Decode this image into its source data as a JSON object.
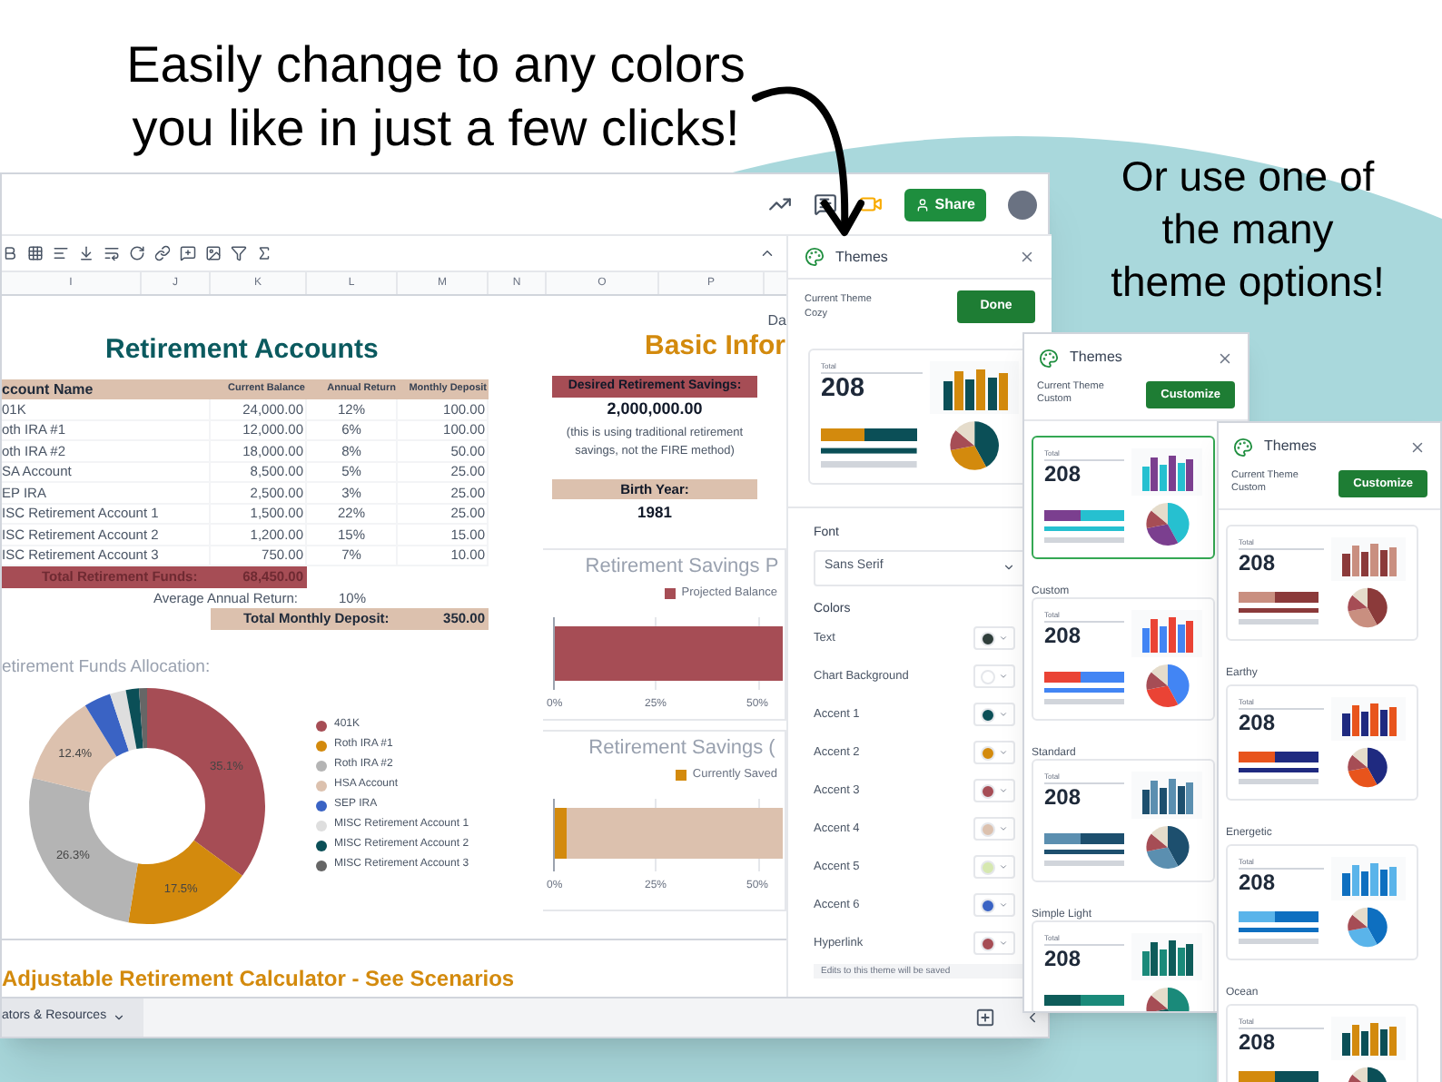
{
  "headline": {
    "lines": [
      "Easily change to any colors",
      "you like in just a few clicks!"
    ]
  },
  "side_note": {
    "lines": [
      "Or use one of",
      "the many",
      "theme options!"
    ]
  },
  "spreadsheet": {
    "share_label": "Share",
    "columns": [
      "I",
      "J",
      "K",
      "L",
      "M",
      "N",
      "O",
      "P"
    ],
    "date_label": "Da",
    "accounts": {
      "title": "Retirement Accounts",
      "headers": [
        "ccount Name",
        "Current Balance",
        "Annual Return",
        "Monthly Deposit"
      ],
      "rows": [
        [
          "01K",
          "24,000.00",
          "12%",
          "100.00"
        ],
        [
          "oth IRA #1",
          "12,000.00",
          "6%",
          "100.00"
        ],
        [
          "oth IRA #2",
          "18,000.00",
          "8%",
          "50.00"
        ],
        [
          "SA Account",
          "8,500.00",
          "5%",
          "25.00"
        ],
        [
          "EP IRA",
          "2,500.00",
          "3%",
          "25.00"
        ],
        [
          "ISC Retirement Account 1",
          "1,500.00",
          "22%",
          "25.00"
        ],
        [
          "ISC Retirement Account 2",
          "1,200.00",
          "15%",
          "15.00"
        ],
        [
          "ISC Retirement Account 3",
          "750.00",
          "7%",
          "10.00"
        ]
      ],
      "total_funds": {
        "label": "Total Retirement Funds:",
        "value": "68,450.00"
      },
      "average_return": {
        "label": "Average Annual Return:",
        "value": "10%"
      },
      "total_deposit": {
        "label": "Total Monthly Deposit:",
        "value": "350.00"
      }
    },
    "allocation": {
      "chart_data": {
        "type": "donut",
        "title": "etirement Funds Allocation:",
        "categories": [
          "401K",
          "Roth IRA #1",
          "Roth IRA #2",
          "HSA Account",
          "SEP IRA",
          "MISC Retirement Account 1",
          "MISC Retirement Account 2",
          "MISC Retirement Account 3"
        ],
        "colors": [
          "#a64d55",
          "#d38a0d",
          "#b4b4b4",
          "#dcc1ae",
          "#3a63c4",
          "#dedede",
          "#0b4f57",
          "#666666"
        ],
        "series": [
          {
            "values": [
              35.1,
              17.5,
              26.3,
              12.4,
              3.7,
              2.2,
              1.8,
              1.1
            ]
          }
        ],
        "legend": "right",
        "value_labels": [
          "35.1%",
          "17.5%",
          "26.3%",
          "12.4%",
          null,
          null,
          null,
          null
        ]
      }
    },
    "basic_info": {
      "title": "Basic Infor",
      "desired_label": "Desired Retirement Savings:",
      "desired_value": "2,000,000.00",
      "note": "(this is using traditional retirement savings, not the FIRE method)",
      "birth_label": "Birth Year:",
      "birth_value": "1981"
    },
    "projection_chart": {
      "title": "Retirement Savings P",
      "legend": "Projected Balance",
      "ticks": [
        "0%",
        "25%",
        "50%"
      ]
    },
    "saved_chart": {
      "title": "Retirement Savings (",
      "legend": "Currently Saved",
      "ticks": [
        "0%",
        "25%",
        "50%"
      ]
    },
    "calculator_heading": "Adjustable Retirement Calculator - See Scenarios",
    "sheet_tab": "ators & Resources"
  },
  "themes_panel": {
    "title": "Themes",
    "current_label": "Current Theme",
    "current_name": "Cozy",
    "button": "Done",
    "preview": {
      "total_label": "Total",
      "total": "208",
      "accents": [
        {
          "color": "#0b4f57"
        },
        {
          "color": "#d38a0d"
        }
      ]
    },
    "font_label": "Font",
    "font_value": "Sans Serif",
    "colors_label": "Colors",
    "colors": [
      {
        "label": "Text",
        "color": "#2f3e3b"
      },
      {
        "label": "Chart Background",
        "color": "#ffffff"
      },
      {
        "label": "Accent 1",
        "color": "#0b4f57"
      },
      {
        "label": "Accent 2",
        "color": "#d38a0d"
      },
      {
        "label": "Accent 3",
        "color": "#a64d55"
      },
      {
        "label": "Accent 4",
        "color": "#dcc1ae"
      },
      {
        "label": "Accent 5",
        "color": "#d6e8b0"
      },
      {
        "label": "Accent 6",
        "color": "#3a63c4"
      },
      {
        "label": "Hyperlink",
        "color": "#a64d55"
      }
    ],
    "note": "Edits to this theme will be saved"
  },
  "gallery_panels": [
    {
      "title": "Themes",
      "current_label": "Current Theme",
      "current_name": "Custom",
      "button": "Customize",
      "themes": [
        {
          "name": "Custom",
          "selected": true,
          "total_label": "Total",
          "total": "208",
          "accents": [
            {
              "color": "#26c0d0"
            },
            {
              "color": "#7b3f8f"
            }
          ]
        },
        {
          "name": "Standard",
          "selected": false,
          "total_label": "Total",
          "total": "208",
          "accents": [
            {
              "color": "#4285f4"
            },
            {
              "color": "#ea4335"
            }
          ]
        },
        {
          "name": "Simple Light",
          "selected": false,
          "total_label": "Total",
          "total": "208",
          "accents": [
            {
              "color": "#1d4f6e"
            },
            {
              "color": "#5b8fb0"
            }
          ]
        },
        {
          "selected": false,
          "total_label": "Total",
          "total": "208",
          "accents": [
            {
              "color": "#1a8a7a"
            },
            {
              "color": "#0e5c5a"
            }
          ]
        }
      ]
    },
    {
      "title": "Themes",
      "current_label": "Current Theme",
      "current_name": "Custom",
      "button": "Customize",
      "themes": [
        {
          "name": "Earthy",
          "selected": false,
          "total_label": "Total",
          "total": "208",
          "accents": [
            {
              "color": "#8b3a3a"
            },
            {
              "color": "#c98f80"
            }
          ]
        },
        {
          "name": "Energetic",
          "selected": false,
          "total_label": "Total",
          "total": "208",
          "accents": [
            {
              "color": "#1f2a80"
            },
            {
              "color": "#e8541c"
            }
          ]
        },
        {
          "name": "Ocean",
          "selected": false,
          "total_label": "Total",
          "total": "208",
          "accents": [
            {
              "color": "#0e6fc0"
            },
            {
              "color": "#5ab4ea"
            }
          ]
        },
        {
          "selected": false,
          "total_label": "Total",
          "total": "208",
          "accents": [
            {
              "color": "#0b4f57"
            },
            {
              "color": "#d38a0d"
            }
          ]
        }
      ]
    }
  ]
}
